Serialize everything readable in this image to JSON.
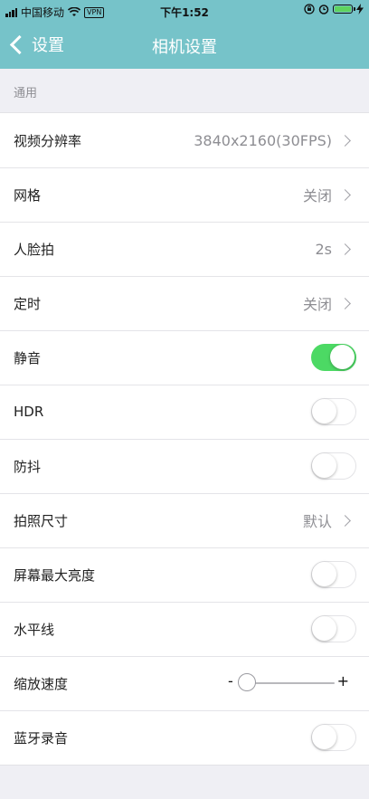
{
  "status_bar": {
    "carrier": "中国移动",
    "vpn": "VPN",
    "time": "下午1:52"
  },
  "nav": {
    "back_label": "设置",
    "title": "相机设置"
  },
  "section": {
    "label": "通用"
  },
  "rows": {
    "video_resolution": {
      "label": "视频分辨率",
      "value": "3840x2160(30FPS)"
    },
    "grid": {
      "label": "网格",
      "value": "关闭"
    },
    "face_shot": {
      "label": "人脸拍",
      "value": "2s"
    },
    "timer": {
      "label": "定时",
      "value": "关闭"
    },
    "mute": {
      "label": "静音",
      "on": true
    },
    "hdr": {
      "label": "HDR",
      "on": false
    },
    "stabilization": {
      "label": "防抖",
      "on": false
    },
    "photo_size": {
      "label": "拍照尺寸",
      "value": "默认"
    },
    "max_brightness": {
      "label": "屏幕最大亮度",
      "on": false
    },
    "horizon_line": {
      "label": "水平线",
      "on": false
    },
    "zoom_speed": {
      "label": "缩放速度",
      "minus": "-",
      "plus": "+",
      "level": 0.0
    },
    "bluetooth_audio": {
      "label": "蓝牙录音",
      "on": false
    }
  },
  "colors": {
    "header_bg": "#76c3c9",
    "toggle_on": "#4cd964",
    "battery_fill": "#5fd35f"
  },
  "icons": [
    "signal-icon",
    "wifi-icon",
    "vpn-badge",
    "lock-rotation-icon",
    "alarm-icon",
    "battery-icon",
    "charging-icon",
    "back-chevron-icon",
    "chevron-right-icon"
  ]
}
